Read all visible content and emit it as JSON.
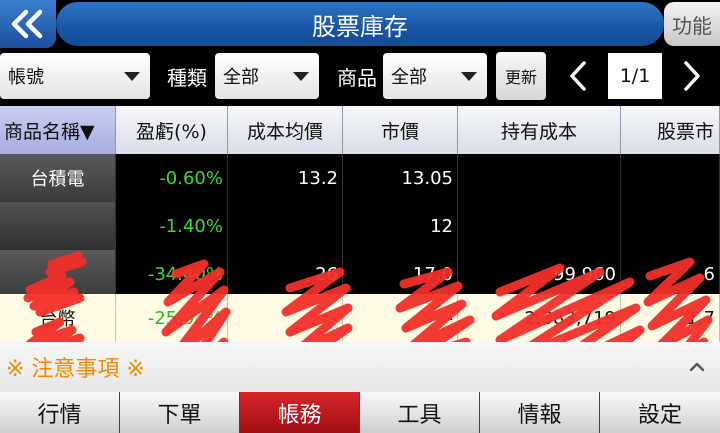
{
  "header": {
    "title": "股票庫存",
    "function_label": "功能"
  },
  "filters": {
    "account": {
      "value": "帳號"
    },
    "type_label": "種類",
    "type": {
      "value": "全部"
    },
    "product_label": "商品",
    "product": {
      "value": "全部"
    },
    "refresh_label": "更新",
    "page_indicator": "1/1"
  },
  "table": {
    "columns": [
      "商品名稱▼",
      "盈虧(%)",
      "成本均價",
      "市價",
      "持有成本",
      "股票市"
    ],
    "rows": [
      {
        "name": "台積電",
        "pnl": "-0.60%",
        "avg_cost": "13.2",
        "price": "13.05",
        "cost": "",
        "value": ""
      },
      {
        "name": "",
        "pnl": "-1.40%",
        "avg_cost": "",
        "price": "12",
        "cost": "",
        "value": ""
      },
      {
        "name": "",
        "pnl": "-34.40%",
        "avg_cost": "26",
        "price": "17.0",
        "cost": "99,960",
        "value": "6"
      }
    ],
    "total": {
      "name": "台幣",
      "pnl": "-25.92%",
      "avg_cost": "-",
      "price": "-",
      "cost": "2,383,719",
      "value": "1,7"
    }
  },
  "notice": {
    "label": "※ 注意事項 ※"
  },
  "nav": {
    "items": [
      {
        "label": "行情"
      },
      {
        "label": "下單"
      },
      {
        "label": "帳務"
      },
      {
        "label": "工具"
      },
      {
        "label": "情報"
      },
      {
        "label": "設定"
      }
    ],
    "active_index": 2
  },
  "colors": {
    "header_blue": "#1a57a8",
    "profit_green": "#33dd33",
    "active_red": "#c41a1f",
    "notice_orange": "#f08a00",
    "redaction_red": "#f2302a"
  }
}
